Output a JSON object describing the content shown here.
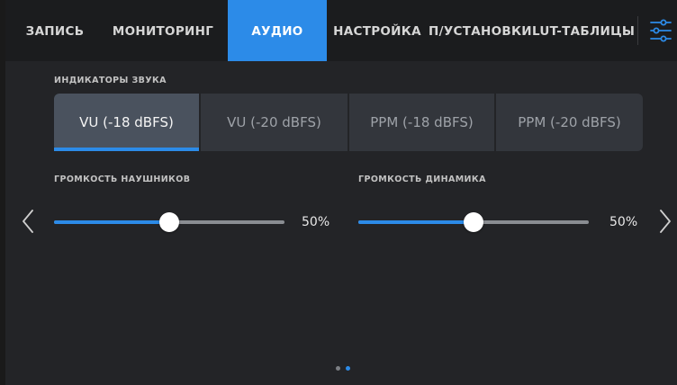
{
  "tabs": [
    {
      "label": "ЗАПИСЬ",
      "active": false
    },
    {
      "label": "МОНИТОРИНГ",
      "active": false
    },
    {
      "label": "АУДИО",
      "active": true
    },
    {
      "label": "НАСТРОЙКА",
      "active": false
    },
    {
      "label": "П/УСТАНОВКИ",
      "active": false
    },
    {
      "label": "LUT-ТАБЛИЦЫ",
      "active": false
    }
  ],
  "settings_icon": "sliders-settings-icon",
  "meters": {
    "label": "ИНДИКАТОРЫ ЗВУКА",
    "options": [
      "VU (-18 dBFS)",
      "VU (-20 dBFS)",
      "PPM (-18 dBFS)",
      "PPM (-20 dBFS)"
    ],
    "selected_index": 0
  },
  "headphones": {
    "label": "ГРОМКОСТЬ НАУШНИКОВ",
    "value": 0.5,
    "value_text": "50%"
  },
  "speaker": {
    "label": "ГРОМКОСТЬ ДИНАМИКА",
    "value": 0.5,
    "value_text": "50%"
  },
  "pager": {
    "pages": 2,
    "current": 1
  },
  "colors": {
    "accent": "#2c8be8",
    "background": "#232427",
    "segment": "#33363c",
    "segment_selected": "#4a525e",
    "track": "#8a8d92",
    "dot_inactive": "#7c7f84"
  }
}
